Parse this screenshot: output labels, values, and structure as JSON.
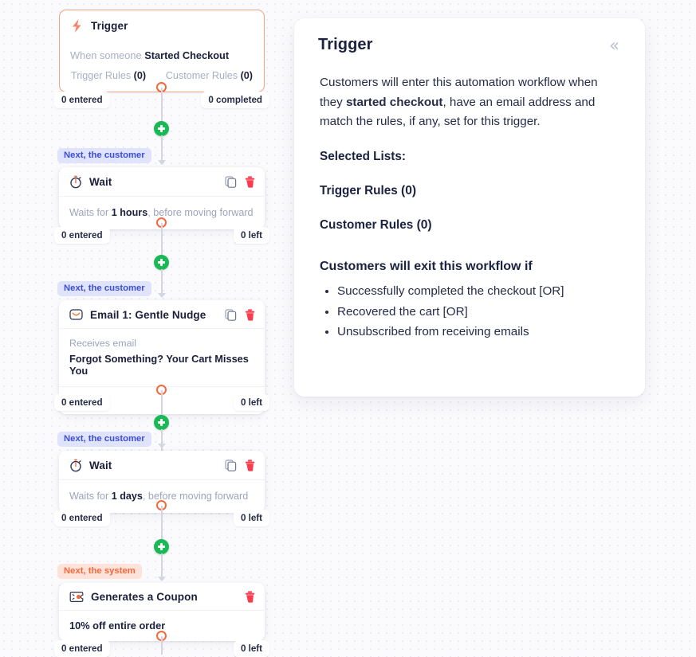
{
  "flow": {
    "nodes": [
      {
        "id": "trigger",
        "kind": "trigger",
        "icon": "lightning-bolt-icon",
        "title": "Trigger",
        "when_prefix": "When someone ",
        "when_event": "Started Checkout",
        "trigger_rules_label": "Trigger Rules ",
        "trigger_rules_count": "(0)",
        "customer_rules_label": "Customer Rules ",
        "customer_rules_count": "(0)",
        "stat_left": "0 entered",
        "stat_right": "0 completed"
      },
      {
        "id": "wait-1",
        "kind": "wait",
        "chip": "Next, the customer",
        "chip_type": "customer",
        "icon": "stopwatch-icon",
        "title": "Wait",
        "body_prefix": "Waits for ",
        "body_value": "1 hours",
        "body_suffix": ", before moving forward",
        "stat_left": "0 entered",
        "stat_right": "0 left"
      },
      {
        "id": "email-1",
        "kind": "email",
        "chip": "Next, the customer",
        "chip_type": "customer",
        "icon": "envelope-icon",
        "title": "Email 1: Gentle Nudge",
        "sub_label": "Receives email",
        "subject": "Forgot Something? Your Cart Misses You",
        "stat_left": "0 entered",
        "stat_right": "0 left"
      },
      {
        "id": "wait-2",
        "kind": "wait",
        "chip": "Next, the customer",
        "chip_type": "customer",
        "icon": "stopwatch-icon",
        "title": "Wait",
        "body_prefix": "Waits for ",
        "body_value": "1 days",
        "body_suffix": ", before moving forward",
        "stat_left": "0 entered",
        "stat_right": "0 left"
      },
      {
        "id": "coupon",
        "kind": "coupon",
        "chip": "Next, the system",
        "chip_type": "system",
        "icon": "coupon-ticket-icon",
        "title": "Generates a Coupon",
        "description": "10% off entire order",
        "stat_left": "0 entered",
        "stat_right": "0 left"
      }
    ],
    "actions": {
      "copy": "copy-icon",
      "delete": "delete-icon",
      "add": "add-step-button",
      "send": "send-icon"
    }
  },
  "panel": {
    "title": "Trigger",
    "collapse_icon": "«",
    "paragraph_parts": {
      "p1": "Customers will enter this automation workflow when they ",
      "bold": "started checkout",
      "p2": ", have an email address and match the rules, if any, set for this trigger."
    },
    "selected_lists_label": "Selected Lists:",
    "trigger_rules_label": "Trigger Rules ",
    "trigger_rules_count": "(0)",
    "customer_rules_label": "Customer Rules ",
    "customer_rules_count": "(0)",
    "exit_heading": "Customers will exit this workflow if",
    "exit_conditions": [
      "Successfully completed the checkout [OR]",
      "Recovered the cart [OR]",
      "Unsubscribed from receiving emails"
    ]
  },
  "colors": {
    "accent_orange": "#f2693c",
    "green_add": "#1ab955",
    "delete_red": "#fa3b4d",
    "chip_customer_bg": "#dfe3fb",
    "chip_customer_text": "#3d4ed6",
    "chip_system_bg": "#ffe2d9",
    "chip_system_text": "#f2693c"
  }
}
